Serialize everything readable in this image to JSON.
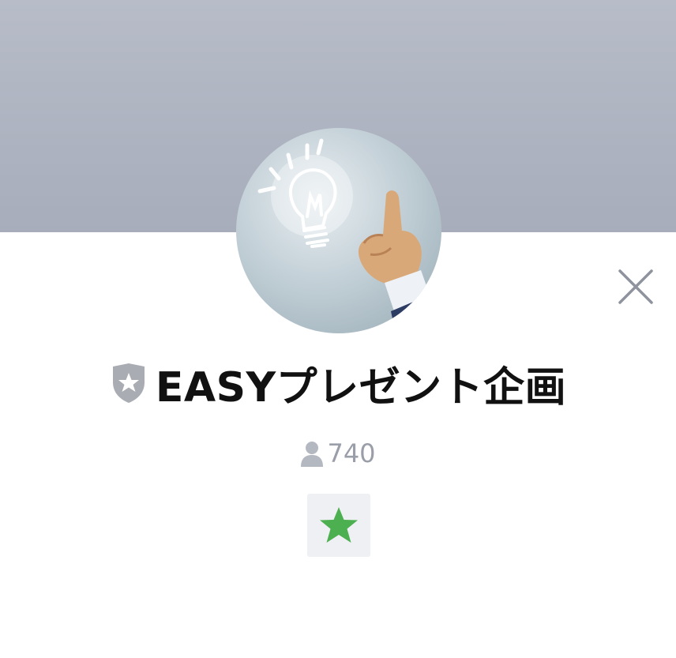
{
  "profile": {
    "name": "EASYプレゼント企画",
    "follower_count": "740"
  },
  "icons": {
    "close": "close-icon",
    "badge": "shield-star-icon",
    "followers": "person-icon",
    "favorite": "star-icon"
  },
  "colors": {
    "cover": "#b2b7c4",
    "favorite_star": "#4caf50",
    "badge": "#a9acb3",
    "follower_text": "#9a9ea8"
  }
}
